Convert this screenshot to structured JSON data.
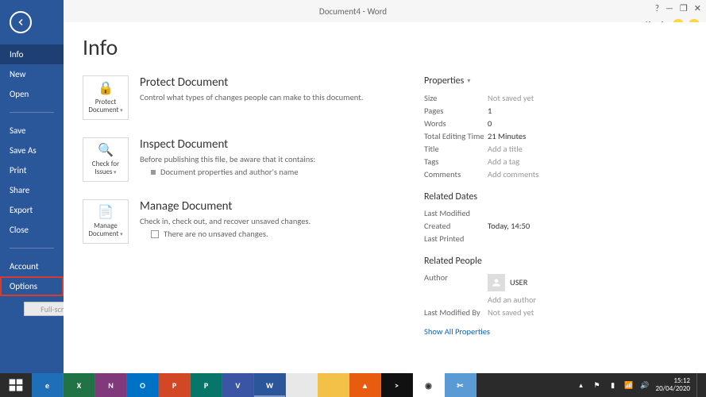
{
  "window": {
    "title": "Document4 - Word"
  },
  "titlebar_controls": {
    "help": "?",
    "minimize": "—",
    "restore": "❐",
    "close": "✕"
  },
  "signin": {
    "label": "Sign in"
  },
  "sidebar": {
    "items": [
      {
        "label": "Info",
        "active": true
      },
      {
        "label": "New"
      },
      {
        "label": "Open"
      },
      {
        "label": "Save"
      },
      {
        "label": "Save As"
      },
      {
        "label": "Print"
      },
      {
        "label": "Share"
      },
      {
        "label": "Export"
      },
      {
        "label": "Close"
      }
    ],
    "footer": [
      {
        "label": "Account"
      },
      {
        "label": "Options",
        "highlight": true
      }
    ]
  },
  "snip": {
    "label": "Full-screen Snip"
  },
  "page": {
    "title": "Info"
  },
  "protect": {
    "title": "Protect Document",
    "desc": "Control what types of changes people can make to this document.",
    "button_line1": "Protect",
    "button_line2": "Document"
  },
  "inspect": {
    "title": "Inspect Document",
    "desc": "Before publishing this file, be aware that it contains:",
    "bullet1": "Document properties and author's name",
    "button_line1": "Check for",
    "button_line2": "Issues"
  },
  "manage": {
    "title": "Manage Document",
    "desc": "Check in, check out, and recover unsaved changes.",
    "changes": "There are no unsaved changes.",
    "button_line1": "Manage",
    "button_line2": "Document"
  },
  "properties": {
    "header": "Properties",
    "rows": [
      {
        "label": "Size",
        "value": "Not saved yet",
        "muted": true
      },
      {
        "label": "Pages",
        "value": "1"
      },
      {
        "label": "Words",
        "value": "0"
      },
      {
        "label": "Total Editing Time",
        "value": "21 Minutes"
      },
      {
        "label": "Title",
        "value": "Add a title",
        "muted": true
      },
      {
        "label": "Tags",
        "value": "Add a tag",
        "muted": true
      },
      {
        "label": "Comments",
        "value": "Add comments",
        "muted": true
      }
    ]
  },
  "related_dates": {
    "header": "Related Dates",
    "rows": [
      {
        "label": "Last Modified",
        "value": ""
      },
      {
        "label": "Created",
        "value": "Today, 14:50"
      },
      {
        "label": "Last Printed",
        "value": ""
      }
    ]
  },
  "related_people": {
    "header": "Related People",
    "author_label": "Author",
    "author_name": "USER",
    "add_author": "Add an author",
    "last_modified_label": "Last Modified By",
    "last_modified_value": "Not saved yet"
  },
  "show_all": {
    "label": "Show All Properties"
  },
  "taskbar": {
    "apps": [
      {
        "name": "ie",
        "bg": "#1e6fb8",
        "text": "e"
      },
      {
        "name": "excel",
        "bg": "#217346",
        "text": "X"
      },
      {
        "name": "onenote",
        "bg": "#80397b",
        "text": "N"
      },
      {
        "name": "outlook",
        "bg": "#0072c6",
        "text": "O"
      },
      {
        "name": "powerpoint",
        "bg": "#d24726",
        "text": "P"
      },
      {
        "name": "publisher",
        "bg": "#077568",
        "text": "P"
      },
      {
        "name": "visio",
        "bg": "#3955a3",
        "text": "V"
      },
      {
        "name": "word",
        "bg": "#2b579a",
        "text": "W",
        "active": true
      },
      {
        "name": "notepad",
        "bg": "#e8e8e8",
        "text": ""
      },
      {
        "name": "explorer",
        "bg": "#f3c048",
        "text": ""
      },
      {
        "name": "vlc",
        "bg": "#e85c0f",
        "text": "▲"
      },
      {
        "name": "cmd",
        "bg": "#111",
        "text": ">"
      },
      {
        "name": "chrome",
        "bg": "#fff",
        "text": "◉"
      },
      {
        "name": "snip",
        "bg": "#5b9bd5",
        "text": "✂"
      }
    ]
  },
  "tray": {
    "time": "15:12",
    "date": "20/04/2020"
  }
}
